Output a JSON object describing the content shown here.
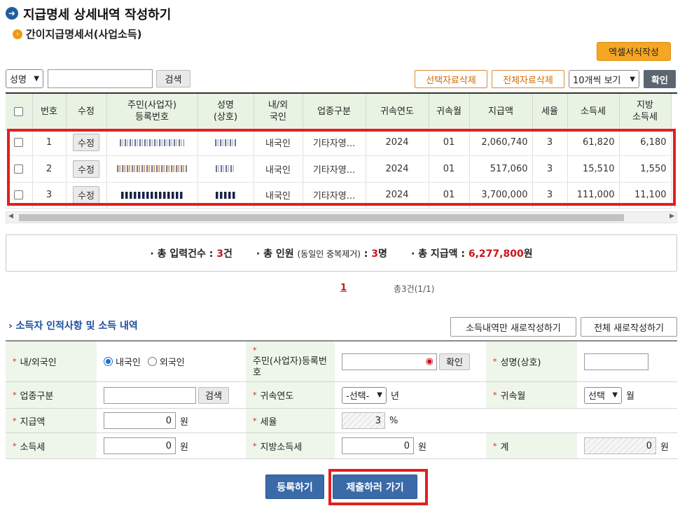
{
  "page": {
    "title": "지급명세 상세내역 작성하기",
    "subtitle": "간이지급명세서(사업소득)",
    "excel_button": "엑셀서식작성"
  },
  "toolbar": {
    "field_select": "성명",
    "search_value": "",
    "search_button": "검색",
    "delete_selected": "선택자료삭제",
    "delete_all": "전체자료삭제",
    "page_size": "10개씩 보기",
    "confirm": "확인"
  },
  "table": {
    "headers": {
      "num": "번호",
      "edit": "수정",
      "id_line1": "주민(사업자)",
      "id_line2": "등록번호",
      "name_line1": "성명",
      "name_line2": "(상호)",
      "nat_line1": "내/외",
      "nat_line2": "국인",
      "biz": "업종구분",
      "year": "귀속연도",
      "month": "귀속월",
      "amount": "지급액",
      "rate": "세율",
      "tax": "소득세",
      "local_line1": "지방",
      "local_line2": "소득세"
    },
    "rows": [
      {
        "num": "1",
        "edit": "수정",
        "nat": "내국인",
        "biz": "기타자영...",
        "year": "2024",
        "month": "01",
        "amount": "2,060,740",
        "rate": "3",
        "tax": "61,820",
        "local": "6,180"
      },
      {
        "num": "2",
        "edit": "수정",
        "nat": "내국인",
        "biz": "기타자영...",
        "year": "2024",
        "month": "01",
        "amount": "517,060",
        "rate": "3",
        "tax": "15,510",
        "local": "1,550"
      },
      {
        "num": "3",
        "edit": "수정",
        "nat": "내국인",
        "biz": "기타자영...",
        "year": "2024",
        "month": "01",
        "amount": "3,700,000",
        "rate": "3",
        "tax": "111,000",
        "local": "11,100"
      }
    ]
  },
  "summary": {
    "count_label": "· 총 입력건수 : ",
    "count_value": "3",
    "count_unit": "건",
    "people_label": "· 총 인원 ",
    "people_note": "(동일인 중복제거)",
    "people_colon": " : ",
    "people_value": "3",
    "people_unit": "명",
    "amount_label": "· 총 지급액 : ",
    "amount_value": "6,277,800",
    "amount_unit": "원"
  },
  "pager": {
    "current": "1",
    "total": "총3건(1/1)"
  },
  "form": {
    "section_title": "소득자 인적사항 및 소득 내역",
    "btn_income_only": "소득내역만 새로작성하기",
    "btn_all_new": "전체 새로작성하기",
    "nat_label": "내/외국인",
    "nat_domestic": "내국인",
    "nat_foreign": "외국인",
    "id_label": "주민(사업자)등록번호",
    "id_confirm": "확인",
    "name_label": "성명(상호)",
    "biz_label": "업종구분",
    "biz_search": "검색",
    "year_label": "귀속연도",
    "year_select": "-선택-",
    "year_unit": "년",
    "month_label": "귀속월",
    "month_select": "선택",
    "month_unit": "월",
    "amount_label": "지급액",
    "amount_value": "0",
    "amount_unit": "원",
    "rate_label": "세율",
    "rate_value": "3",
    "rate_unit": "%",
    "tax_label": "소득세",
    "tax_value": "0",
    "tax_unit": "원",
    "local_label": "지방소득세",
    "local_value": "0",
    "local_unit": "원",
    "total_label": "계",
    "total_value": "0",
    "total_unit": "원",
    "required_mark": "*"
  },
  "actions": {
    "register": "등록하기",
    "submit": "제출하러 가기"
  },
  "colors": {
    "primary_blue": "#3b6aa9",
    "accent_orange": "#f5a623",
    "highlight_red": "#e0201f",
    "header_green": "#e9f3e4"
  }
}
